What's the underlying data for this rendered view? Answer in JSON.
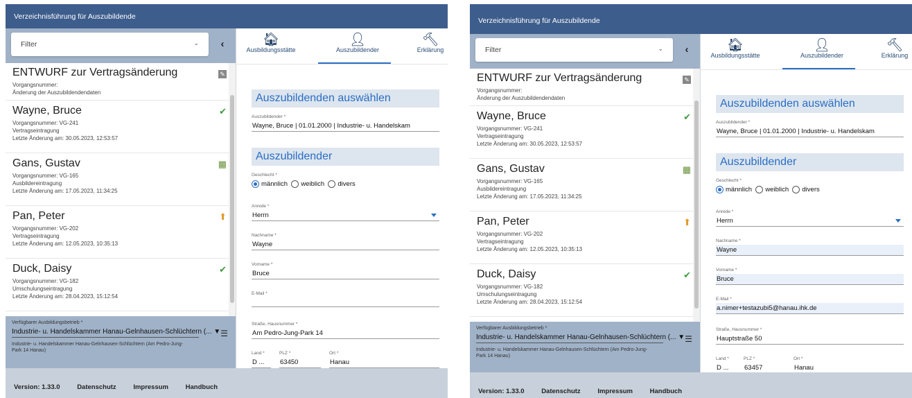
{
  "app_title": "Verzeichnisführung für Auszubildende",
  "filter": {
    "placeholder": "Filter"
  },
  "tabs": {
    "ausbildungsstaette": "Ausbildungsstätte",
    "auszubildender": "Auszubildender",
    "erklaerung": "Erklärung"
  },
  "icons": {
    "tab_1": "house-icon",
    "tab_2": "person-icon",
    "tab_3": "gavel-icon"
  },
  "list": [
    {
      "name": "ENTWURF zur Vertragsänderung",
      "line1": "Vorgangsnummer:",
      "line2": "Änderung der Auszubildendendaten",
      "line3": "",
      "status": "edit"
    },
    {
      "name": "Wayne, Bruce",
      "line1": "Vorgangsnummer: VG-241",
      "line2": "Vertragseintragung",
      "line3": "Letzte Änderung am: 30.05.2023, 12:53:57",
      "status": "check"
    },
    {
      "name": "Gans, Gustav",
      "line1": "Vorgangsnummer: VG-165",
      "line2": "Ausbildereintragung",
      "line3": "Letzte Änderung am: 17.05.2023, 11:34:25",
      "status": "calendar"
    },
    {
      "name": "Pan, Peter",
      "line1": "Vorgangsnummer: VG-202",
      "line2": "Vertragseintragung",
      "line3": "Letzte Änderung am: 12.05.2023, 10:35:13",
      "status": "upload"
    },
    {
      "name": "Duck, Daisy",
      "line1": "Vorgangsnummer: VG-182",
      "line2": "Umschulungseintragung",
      "line3": "Letzte Änderung am: 28.04.2023, 15:12:54",
      "status": "check"
    }
  ],
  "betrieb": {
    "label": "Verfügbarer Ausbildungsbetrieb *",
    "value": "Industrie- u. Handelskammer Hanau-Gelnhausen-Schlüchtern (...",
    "value_full": "Industrie- u. Handelskammer Hanau-Gelnhausen-Schlüchtern (Am Pedro-Jung-Park 14 Hanau)"
  },
  "sections": {
    "select_title": "Auszubildenden auswählen",
    "person_title": "Auszubildender"
  },
  "labels": {
    "azubi": "Auszubildender *",
    "gender": "Geschlecht *",
    "anrede": "Anrede *",
    "nachname": "Nachname *",
    "vorname": "Vorname *",
    "email": "E-Mail *",
    "strasse": "Straße, Hausnummer *",
    "land": "Land *",
    "plz": "PLZ *",
    "ort": "Ort *"
  },
  "gender_options": {
    "m": "männlich",
    "w": "weiblich",
    "d": "divers"
  },
  "form1": {
    "azubi": "Wayne, Bruce | 01.01.2000 | Industrie- u. Handelskam",
    "anrede": "Herrn",
    "nachname": "Wayne",
    "vorname": "Bruce",
    "email": "",
    "strasse": "Am Pedro-Jung-Park 14",
    "land": "D ...",
    "plz": "63450",
    "ort": "Hanau"
  },
  "form2": {
    "azubi": "Wayne, Bruce | 01.01.2000 | Industrie- u. Handelskam",
    "anrede": "Herrn",
    "nachname": "Wayne",
    "vorname": "Bruce",
    "email": "a.nimer+testazubi5@hanau.ihk.de",
    "strasse": "Hauptstraße 50",
    "land": "D ...",
    "plz": "63457",
    "ort": "Hanau"
  },
  "footer": {
    "version": "Version: 1.33.0",
    "datenschutz": "Datenschutz",
    "impressum": "Impressum",
    "handbuch": "Handbuch"
  },
  "colors": {
    "header": "#3d5d8c",
    "accent": "#2a6ec4",
    "panel": "#a0b2c8",
    "footer": "#c8d1db"
  }
}
